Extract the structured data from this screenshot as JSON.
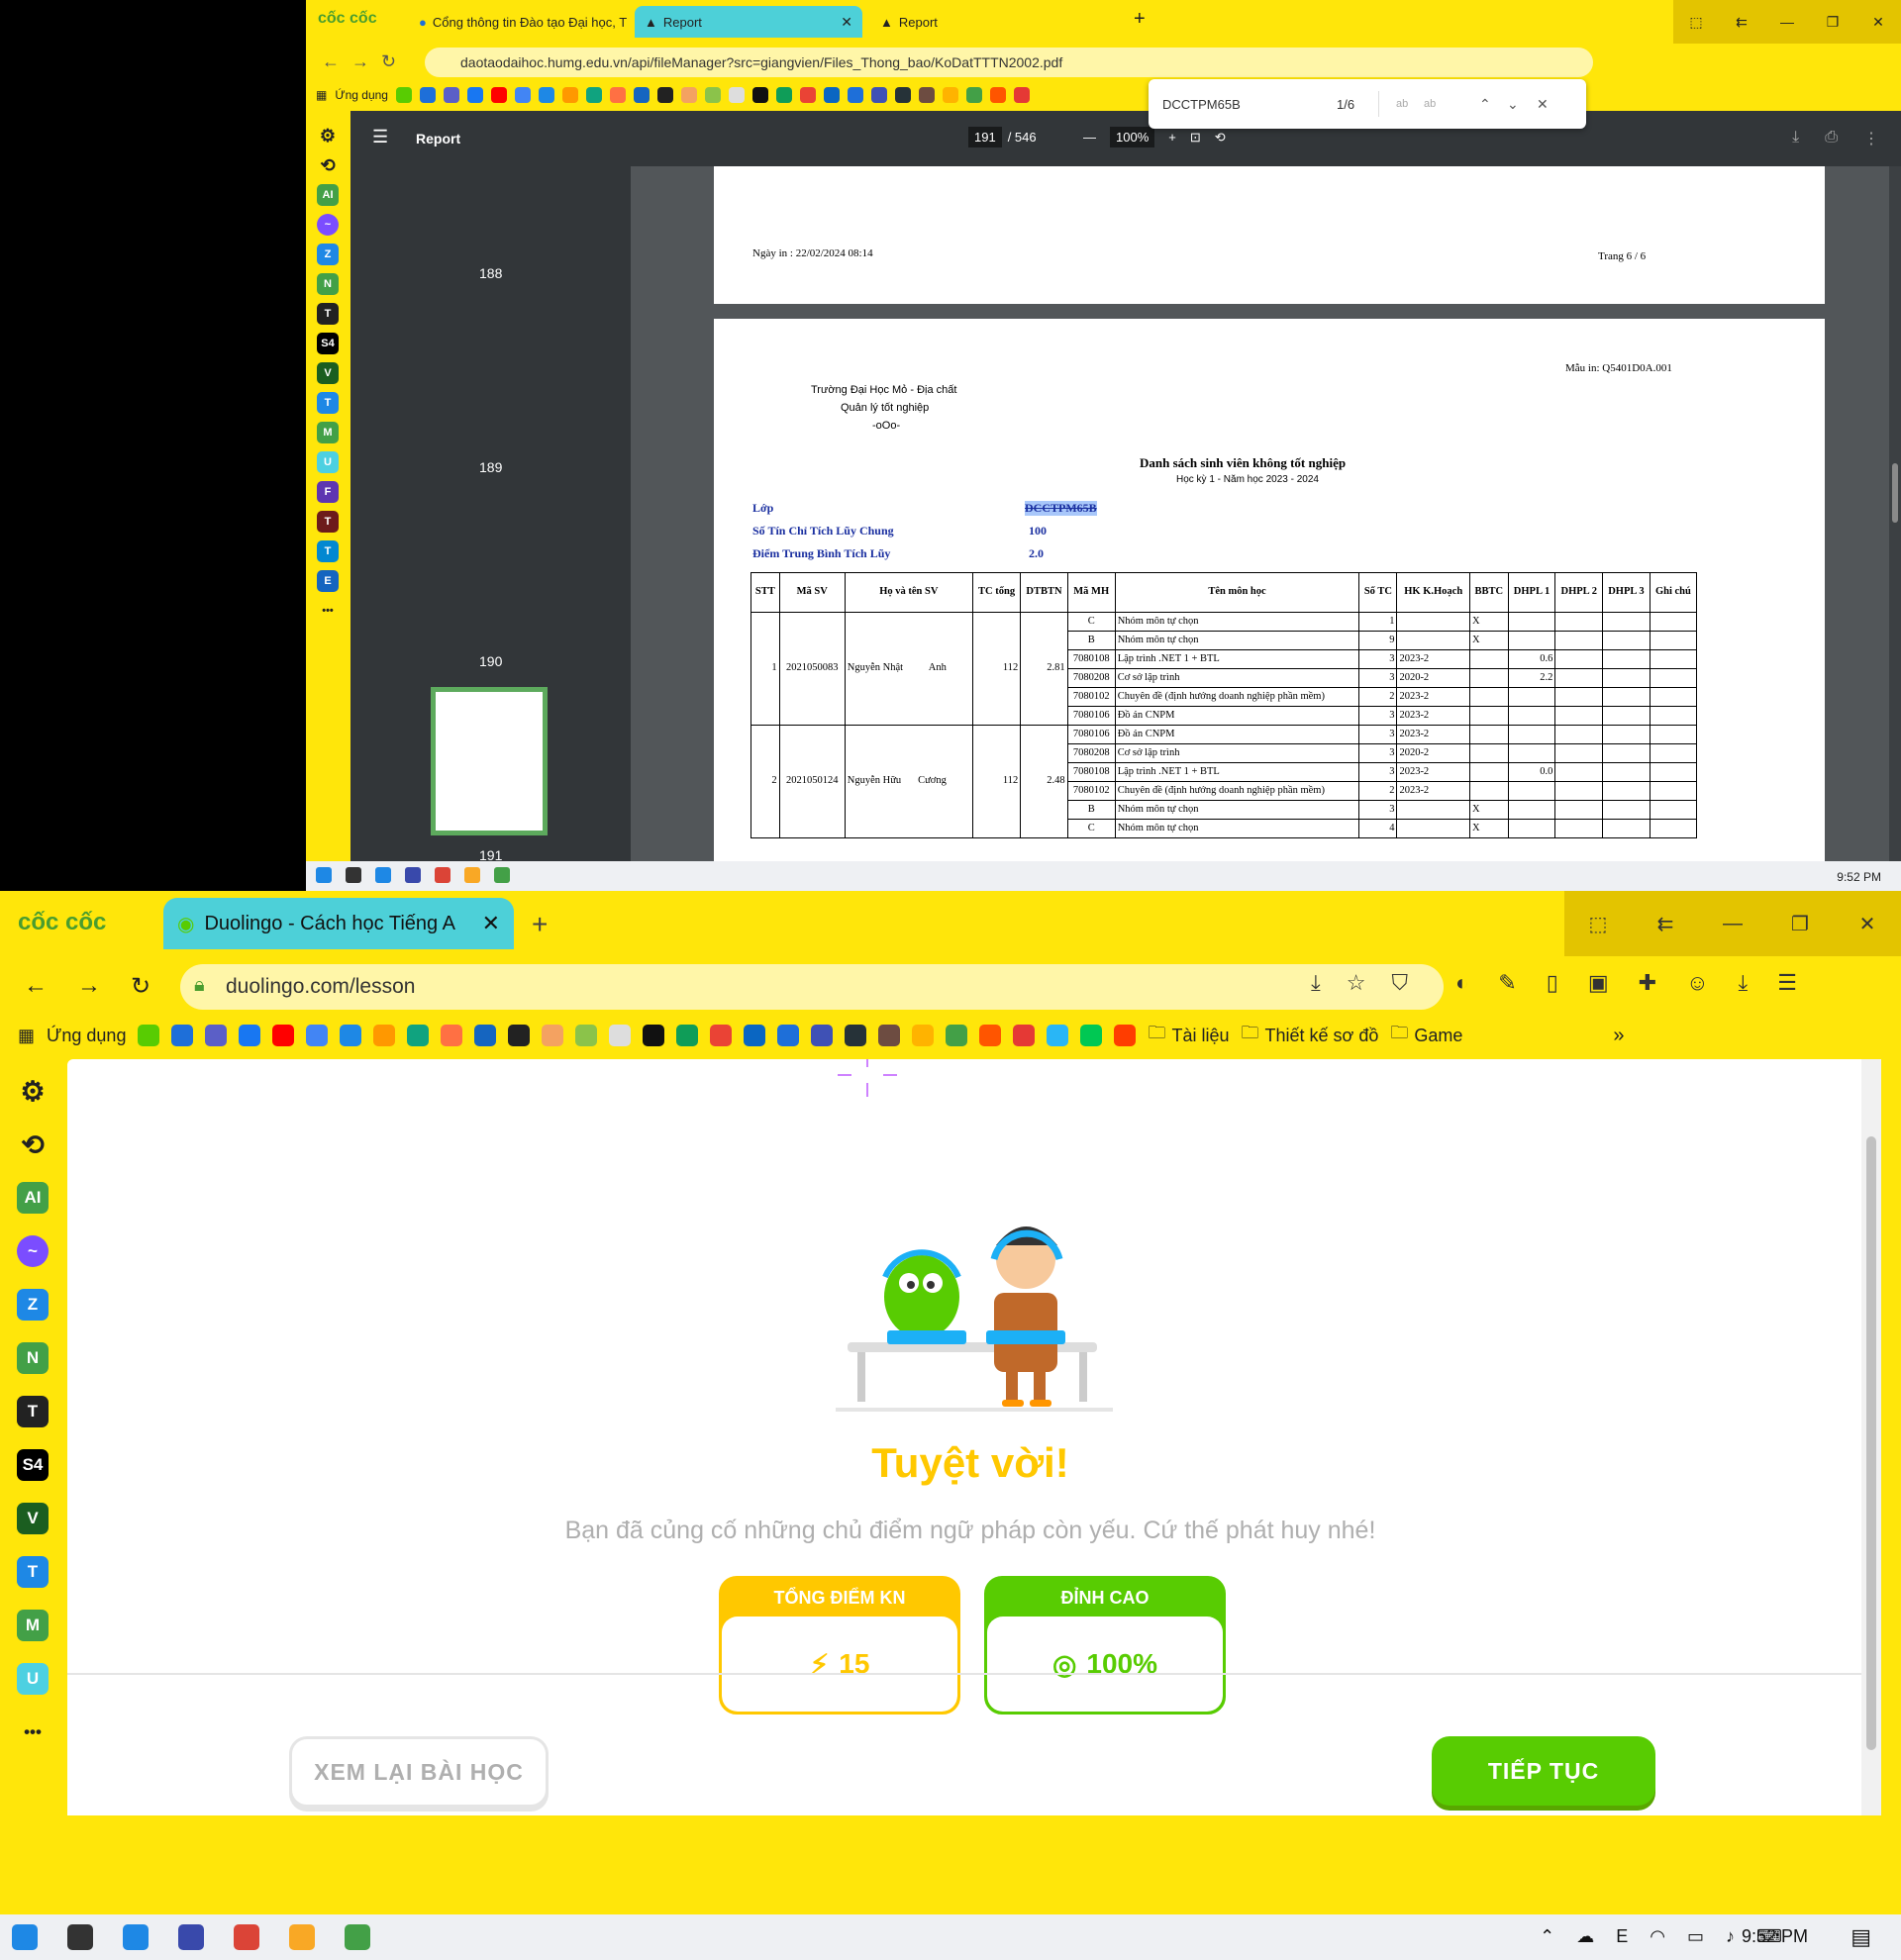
{
  "browser_top": {
    "logo": "cốc cốc",
    "tabs": [
      {
        "label": "Cổng thông tin Đào tạo Đại học, T"
      },
      {
        "label": "Report"
      },
      {
        "label": "Report"
      }
    ],
    "url": "daotaodaihoc.humg.edu.vn/api/fileManager?src=giangvien/Files_Thong_bao/KoDatTTTN2002.pdf",
    "bookmarks_label": "Ứng dụng",
    "find": {
      "query": "DCCTPM65B",
      "count": "1/6"
    }
  },
  "pdf": {
    "title": "Report",
    "page_current": "191",
    "page_total": "/ 546",
    "zoom": "100%",
    "thumb_numbers": [
      "188",
      "189",
      "190",
      "191"
    ],
    "pageA": {
      "date": "Ngày in : 22/02/2024 08:14",
      "page": "Trang 6 / 6"
    },
    "pageB": {
      "form_code": "Mẫu in: Q5401D0A.001",
      "school": "Trường Đại Học Mỏ - Địa chất",
      "dept": "Quản lý tốt nghiệp",
      "deco": "-oOo-",
      "title": "Danh sách sinh viên không tốt nghiệp",
      "subtitle": "Học kỳ 1 - Năm học 2023 - 2024",
      "lop_label": "Lớp",
      "lop_value": "DCCTPM65B",
      "tc_label": "Số Tín Chỉ Tích Lũy Chung",
      "tc_value": "100",
      "dtb_label": "Điểm Trung Bình Tích Lũy",
      "dtb_value": "2.0",
      "headers": [
        "STT",
        "Mã SV",
        "Họ và tên SV",
        "TC tổng",
        "DTBTN",
        "Mã MH",
        "Tên môn học",
        "Số TC",
        "HK K.Hoạch",
        "BBTC",
        "DHPL 1",
        "DHPL 2",
        "DHPL 3",
        "Ghi chú"
      ],
      "students": [
        {
          "stt": "1",
          "masv": "2021050083",
          "ho": "Nguyễn Nhật",
          "ten": "Anh",
          "tc": "112",
          "dtb": "2.81",
          "rows": [
            [
              "C",
              "Nhóm môn tự chọn",
              "1",
              "",
              "X",
              "",
              ""
            ],
            [
              "B",
              "Nhóm môn tự chọn",
              "9",
              "",
              "X",
              "",
              ""
            ],
            [
              "7080108",
              "Lập trình .NET 1 + BTL",
              "3",
              "2023-2",
              "",
              "0.6",
              ""
            ],
            [
              "7080208",
              "Cơ sở lập trình",
              "3",
              "2020-2",
              "",
              "2.2",
              ""
            ],
            [
              "7080102",
              "Chuyên đề (định hướng doanh nghiệp phần mềm)",
              "2",
              "2023-2",
              "",
              "",
              ""
            ],
            [
              "7080106",
              "Đồ án CNPM",
              "3",
              "2023-2",
              "",
              "",
              ""
            ]
          ]
        },
        {
          "stt": "2",
          "masv": "2021050124",
          "ho": "Nguyễn Hữu",
          "ten": "Cương",
          "tc": "112",
          "dtb": "2.48",
          "rows": [
            [
              "7080106",
              "Đồ án CNPM",
              "3",
              "2023-2",
              "",
              "",
              ""
            ],
            [
              "7080208",
              "Cơ sở lập trình",
              "3",
              "2020-2",
              "",
              "",
              ""
            ],
            [
              "7080108",
              "Lập trình .NET 1 + BTL",
              "3",
              "2023-2",
              "",
              "0.0",
              ""
            ],
            [
              "7080102",
              "Chuyên đề (định hướng doanh nghiệp phần mềm)",
              "2",
              "2023-2",
              "",
              "",
              ""
            ],
            [
              "B",
              "Nhóm môn tự chọn",
              "3",
              "",
              "X",
              "",
              ""
            ],
            [
              "C",
              "Nhóm môn tự chọn",
              "4",
              "",
              "X",
              "",
              ""
            ]
          ]
        }
      ]
    }
  },
  "taskbar_top": {
    "clock": "9:52 PM"
  },
  "browser_bottom": {
    "logo": "cốc cốc",
    "tab": "Duolingo - Cách học Tiếng A",
    "url": "duolingo.com/lesson",
    "bookmarks_label": "Ứng dụng",
    "folders": [
      "Tài liệu",
      "Thiết kế sơ đồ",
      "Game"
    ]
  },
  "lesson": {
    "heading": "Tuyệt vời!",
    "message": "Bạn đã củng cố những chủ điểm ngữ pháp còn yếu. Cứ thế phát huy nhé!",
    "xp_label": "TỔNG ĐIỂM KN",
    "xp_value": "15",
    "acc_label": "ĐỈNH CAO",
    "acc_value": "100%",
    "review_button": "XEM LẠI BÀI HỌC",
    "continue_button": "TIẾP TỤC",
    "colors": {
      "gold": "#ffc800",
      "green": "#58cc02"
    }
  },
  "taskbar_bottom": {
    "clock": "9:52 PM"
  }
}
